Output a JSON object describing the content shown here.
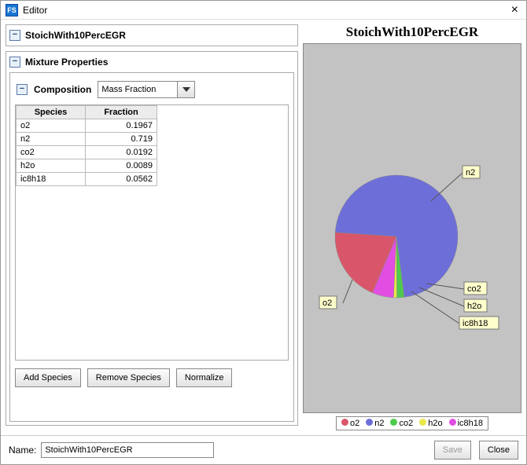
{
  "window": {
    "title": "Editor",
    "close": "×"
  },
  "panel": {
    "title": "StoichWith10PercEGR"
  },
  "mixture": {
    "title": "Mixture Properties",
    "composition_label": "Composition",
    "mode": "Mass Fraction",
    "headers": {
      "species": "Species",
      "fraction": "Fraction"
    },
    "rows": [
      {
        "species": "o2",
        "fraction": "0.1967"
      },
      {
        "species": "n2",
        "fraction": "0.719"
      },
      {
        "species": "co2",
        "fraction": "0.0192"
      },
      {
        "species": "h2o",
        "fraction": "0.0089"
      },
      {
        "species": "ic8h18",
        "fraction": "0.0562"
      }
    ],
    "buttons": {
      "add": "Add Species",
      "remove": "Remove Species",
      "normalize": "Normalize"
    }
  },
  "chart": {
    "title": "StoichWith10PercEGR"
  },
  "chart_data": {
    "type": "pie",
    "title": "StoichWith10PercEGR",
    "categories": [
      "o2",
      "n2",
      "co2",
      "h2o",
      "ic8h18"
    ],
    "values": [
      0.1967,
      0.719,
      0.0192,
      0.0089,
      0.0562
    ],
    "colors": [
      "#d9566a",
      "#6e6ed9",
      "#4ecb4e",
      "#e8e84a",
      "#e24ee2"
    ]
  },
  "legend": {
    "items": [
      {
        "label": "o2"
      },
      {
        "label": "n2"
      },
      {
        "label": "co2"
      },
      {
        "label": "h2o"
      },
      {
        "label": "ic8h18"
      }
    ]
  },
  "footer": {
    "name_label": "Name:",
    "name_value": "StoichWith10PercEGR",
    "save": "Save",
    "close": "Close"
  }
}
